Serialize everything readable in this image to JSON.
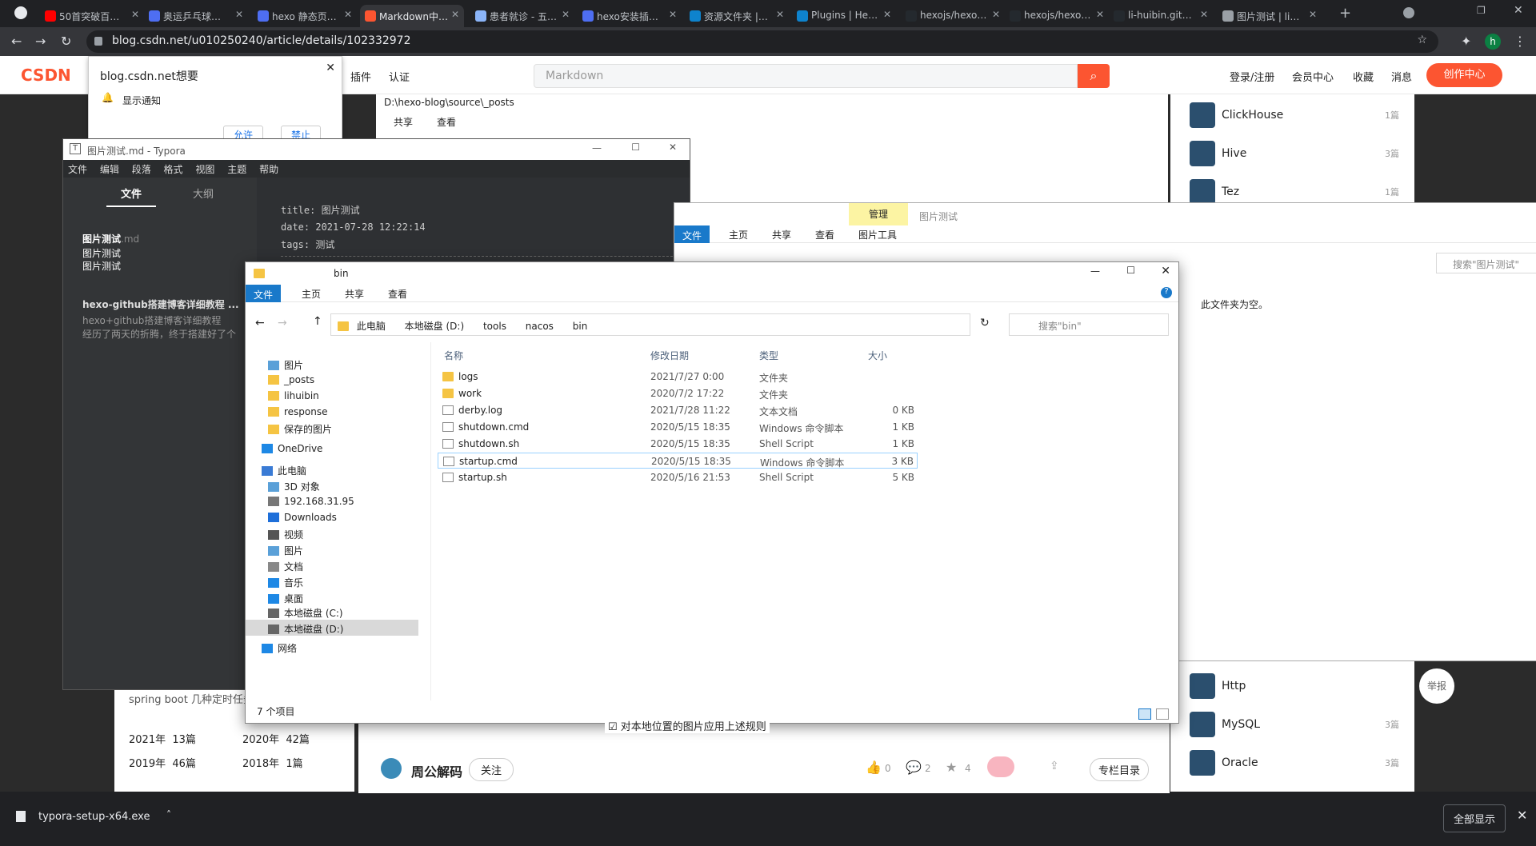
{
  "browser": {
    "tabs": [
      {
        "label": "50首突破百…",
        "color": "#ff0000"
      },
      {
        "label": "奥运乒乓球…",
        "color": "#4e6ef2"
      },
      {
        "label": "hexo 静态页…",
        "color": "#4e6ef2"
      },
      {
        "label": "Markdown中…",
        "color": "#fc5531"
      },
      {
        "label": "患者就诊 - 五…",
        "color": "#8ab4f8"
      },
      {
        "label": "hexo安装插…",
        "color": "#4e6ef2"
      },
      {
        "label": "资源文件夹 |…",
        "color": "#0e83cd"
      },
      {
        "label": "Plugins | He…",
        "color": "#0e83cd"
      },
      {
        "label": "hexojs/hexo…",
        "color": "#24292e"
      },
      {
        "label": "hexojs/hexo…",
        "color": "#24292e"
      },
      {
        "label": "li-huibin.git…",
        "color": "#24292e"
      },
      {
        "label": "图片测试 | li…",
        "color": "#9aa0a6"
      }
    ],
    "url": "blog.csdn.net/u010250240/article/details/102332972",
    "avatar": "h"
  },
  "csdn": {
    "logo": "CSDN",
    "nav": [
      "插件",
      "认证"
    ],
    "search_placeholder": "Markdown",
    "right": [
      "登录/注册",
      "会员中心",
      "收藏",
      "消息"
    ],
    "create_btn": "创作中心"
  },
  "notification": {
    "title": "blog.csdn.net想要",
    "item": "显示通知",
    "allow": "允许",
    "block": "禁止"
  },
  "behind_explorer": {
    "path": "D:\\hexo-blog\\source\\_posts",
    "tabs": [
      "共享",
      "查看"
    ]
  },
  "typora": {
    "title": "图片测试.md - Typora",
    "menu": [
      "文件",
      "编辑",
      "段落",
      "格式",
      "视图",
      "主题",
      "帮助"
    ],
    "side_tabs": [
      "文件",
      "大纲"
    ],
    "files": [
      {
        "name": "图片测试",
        "ext": ".md"
      },
      {
        "name": "图片测试"
      },
      {
        "name": "图片测试"
      }
    ],
    "front_matter": [
      "title: 图片测试",
      "date: 2021-07-28 12:22:14",
      "tags: 测试"
    ],
    "recent_title": "hexo-github搭建博客详细教程 ...",
    "recent_line1": "hexo+github搭建博客详细教程",
    "recent_line2": "经历了两天的折腾，终于搭建好了个"
  },
  "explorer2": {
    "manage": "管理",
    "title": "图片测试",
    "ribbon": [
      "文件",
      "主页",
      "共享",
      "查看",
      "图片工具"
    ],
    "search_placeholder": "搜索\"图片测试\"",
    "empty": "此文件夹为空。"
  },
  "explorer": {
    "title": "bin",
    "ribbon": [
      "文件",
      "主页",
      "共享",
      "查看"
    ],
    "breadcrumb": [
      "此电脑",
      "本地磁盘 (D:)",
      "tools",
      "nacos",
      "bin"
    ],
    "search_placeholder": "搜索\"bin\"",
    "nav": [
      "图片",
      "_posts",
      "lihuibin",
      "response",
      "保存的图片",
      "OneDrive",
      "此电脑",
      "3D 对象",
      "192.168.31.95",
      "Downloads",
      "视频",
      "图片",
      "文档",
      "音乐",
      "桌面",
      "本地磁盘 (C:)",
      "本地磁盘 (D:)",
      "网络"
    ],
    "columns": [
      "名称",
      "修改日期",
      "类型",
      "大小"
    ],
    "files": [
      {
        "name": "logs",
        "date": "2021/7/27 0:00",
        "type": "文件夹",
        "size": "",
        "kind": "folder"
      },
      {
        "name": "work",
        "date": "2020/7/2 17:22",
        "type": "文件夹",
        "size": "",
        "kind": "folder"
      },
      {
        "name": "derby.log",
        "date": "2021/7/28 11:22",
        "type": "文本文档",
        "size": "0 KB",
        "kind": "doc"
      },
      {
        "name": "shutdown.cmd",
        "date": "2020/5/15 18:35",
        "type": "Windows 命令脚本",
        "size": "1 KB",
        "kind": "cmd"
      },
      {
        "name": "shutdown.sh",
        "date": "2020/5/15 18:35",
        "type": "Shell Script",
        "size": "1 KB",
        "kind": "doc"
      },
      {
        "name": "startup.cmd",
        "date": "2020/5/15 18:35",
        "type": "Windows 命令脚本",
        "size": "3 KB",
        "kind": "cmd"
      },
      {
        "name": "startup.sh",
        "date": "2020/5/16 21:53",
        "type": "Shell Script",
        "size": "5 KB",
        "kind": "doc"
      }
    ],
    "status": "7 个项目"
  },
  "tags": [
    {
      "name": "ClickHouse",
      "count": "1篇"
    },
    {
      "name": "Hive",
      "count": "3篇"
    },
    {
      "name": "Tez",
      "count": "1篇"
    },
    {
      "name": "Http",
      "count": ""
    },
    {
      "name": "MySQL",
      "count": "3篇"
    },
    {
      "name": "Oracle",
      "count": "3篇"
    }
  ],
  "report": "举报",
  "left_card": {
    "truncated": "spring boot 几种定时任务",
    "archive": [
      "2021年  13篇",
      "2020年  42篇",
      "2019年  46篇",
      "2018年  1篇"
    ]
  },
  "article_footer": {
    "checkbox": "对本地位置的图片应用上述规则",
    "author": "周公解码",
    "follow": "关注",
    "likes": "0",
    "comments": "2",
    "stars": "4",
    "catalog": "专栏目录"
  },
  "download": {
    "file": "typora-setup-x64.exe",
    "show_all": "全部显示"
  }
}
